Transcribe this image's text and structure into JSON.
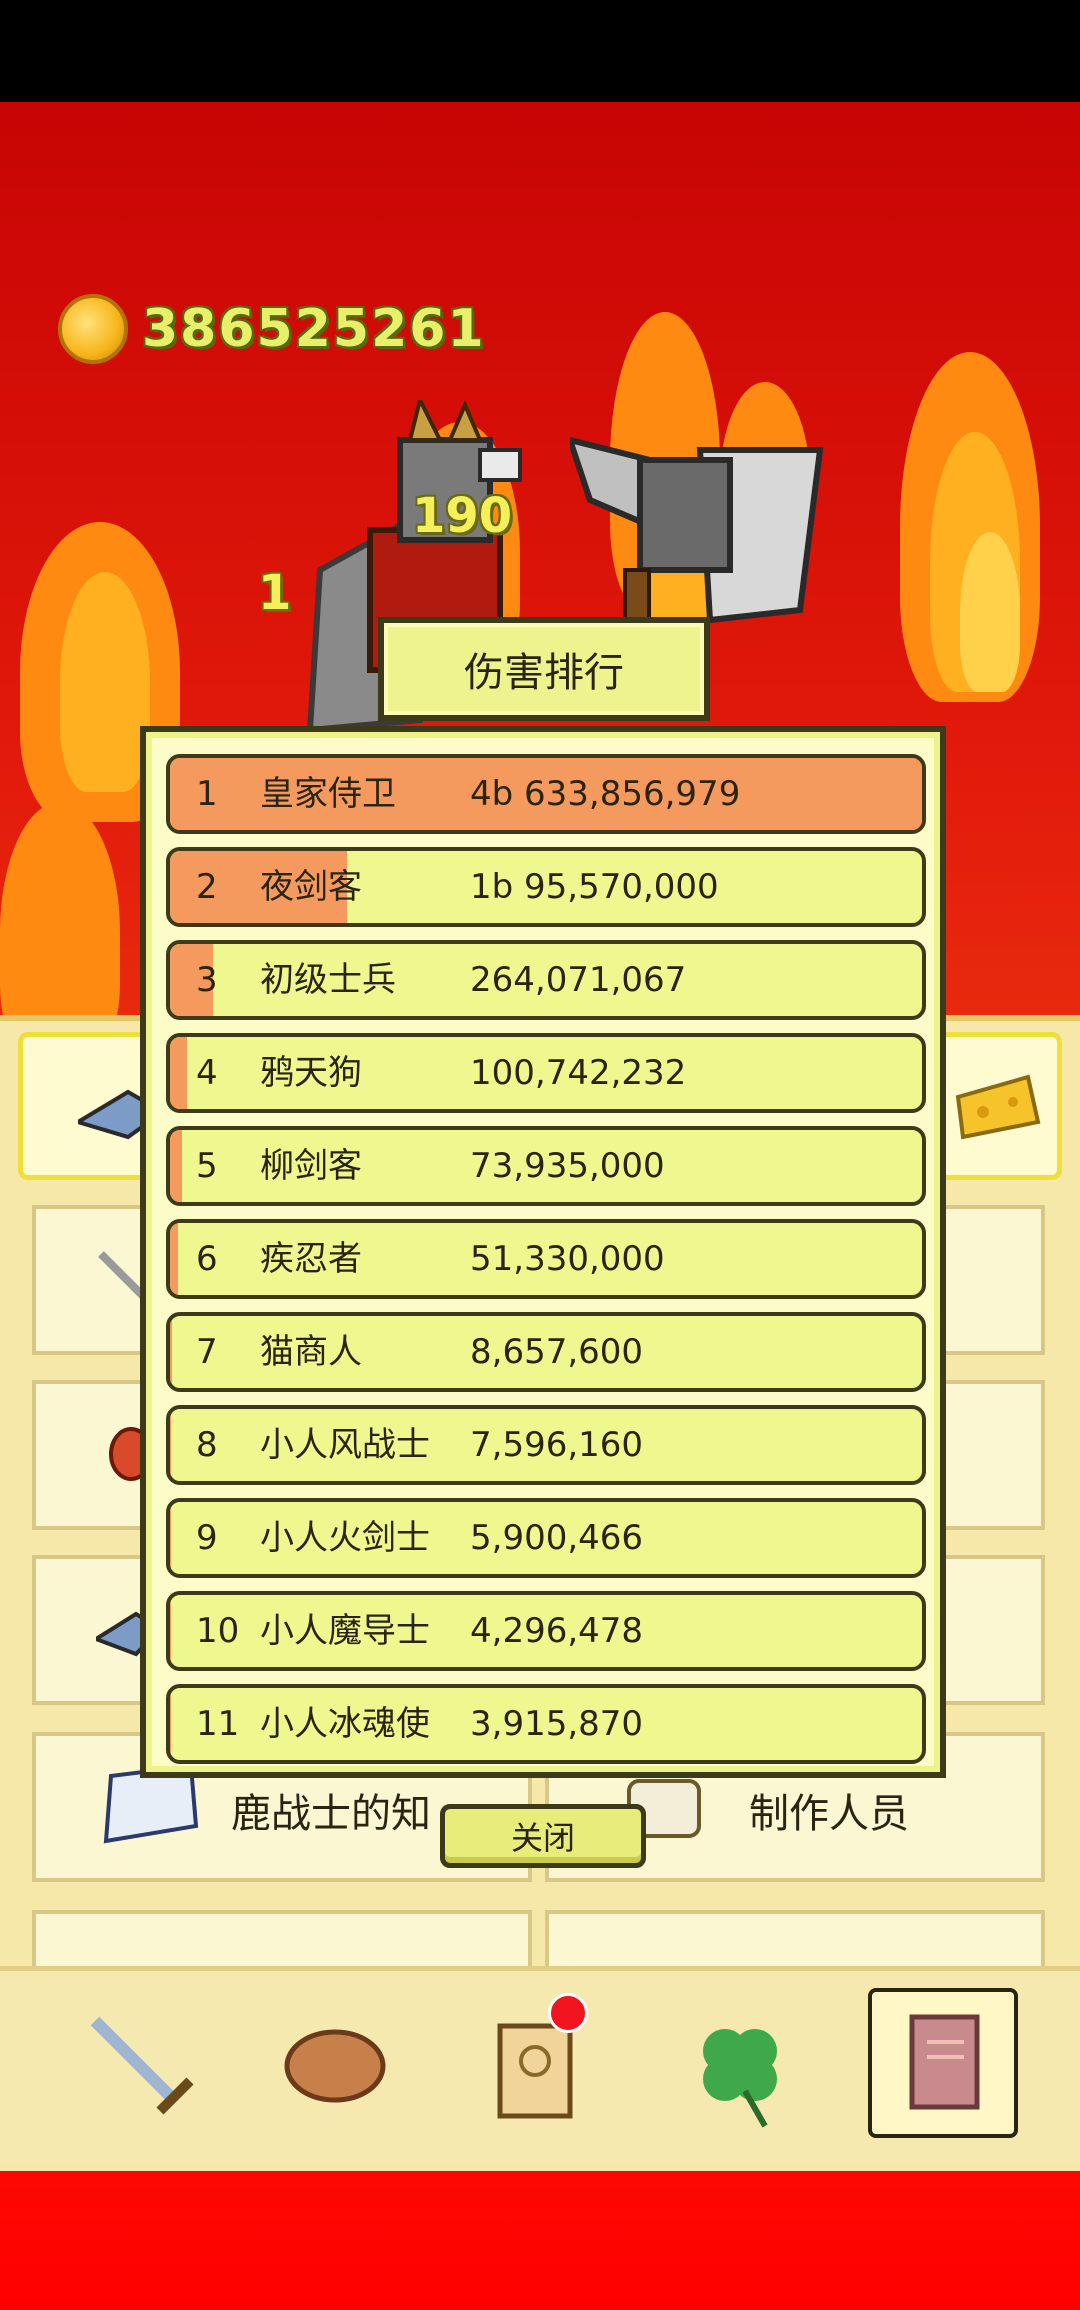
{
  "currency": {
    "amount": "386525261",
    "icon": "gold-coin-icon"
  },
  "floating_numbers": [
    "190",
    "1"
  ],
  "modal": {
    "title": "伤害排行",
    "close_label": "关闭",
    "accent_color": "#f59a5e",
    "rows": [
      {
        "rank": "1",
        "name": "皇家侍卫",
        "value": "4b 633,856,979",
        "share": 1.0
      },
      {
        "rank": "2",
        "name": "夜剑客",
        "value": "1b 95,570,000",
        "share": 0.236
      },
      {
        "rank": "3",
        "name": "初级士兵",
        "value": "264,071,067",
        "share": 0.057
      },
      {
        "rank": "4",
        "name": "鸦天狗",
        "value": "100,742,232",
        "share": 0.022
      },
      {
        "rank": "5",
        "name": "柳剑客",
        "value": "73,935,000",
        "share": 0.016
      },
      {
        "rank": "6",
        "name": "疾忍者",
        "value": "51,330,000",
        "share": 0.011
      },
      {
        "rank": "7",
        "name": "猫商人",
        "value": "8,657,600",
        "share": 0.002
      },
      {
        "rank": "8",
        "name": "小人风战士",
        "value": "7,596,160",
        "share": 0.0016
      },
      {
        "rank": "9",
        "name": "小人火剑士",
        "value": "5,900,466",
        "share": 0.0013
      },
      {
        "rank": "10",
        "name": "小人魔导士",
        "value": "4,296,478",
        "share": 0.0009
      },
      {
        "rank": "11",
        "name": "小人冰魂使",
        "value": "3,915,870",
        "share": 0.0008
      }
    ]
  },
  "menu": {
    "cards": [
      {
        "label": "鹿战士的知",
        "icon": "book-icon"
      },
      {
        "label": "制作人员",
        "icon": "cup-icon"
      }
    ]
  },
  "nav": {
    "items": [
      {
        "icon": "sword-icon"
      },
      {
        "icon": "bread-icon"
      },
      {
        "icon": "scroll-icon",
        "badge": true
      },
      {
        "icon": "clover-icon"
      },
      {
        "icon": "book-icon",
        "selected": true
      }
    ]
  }
}
